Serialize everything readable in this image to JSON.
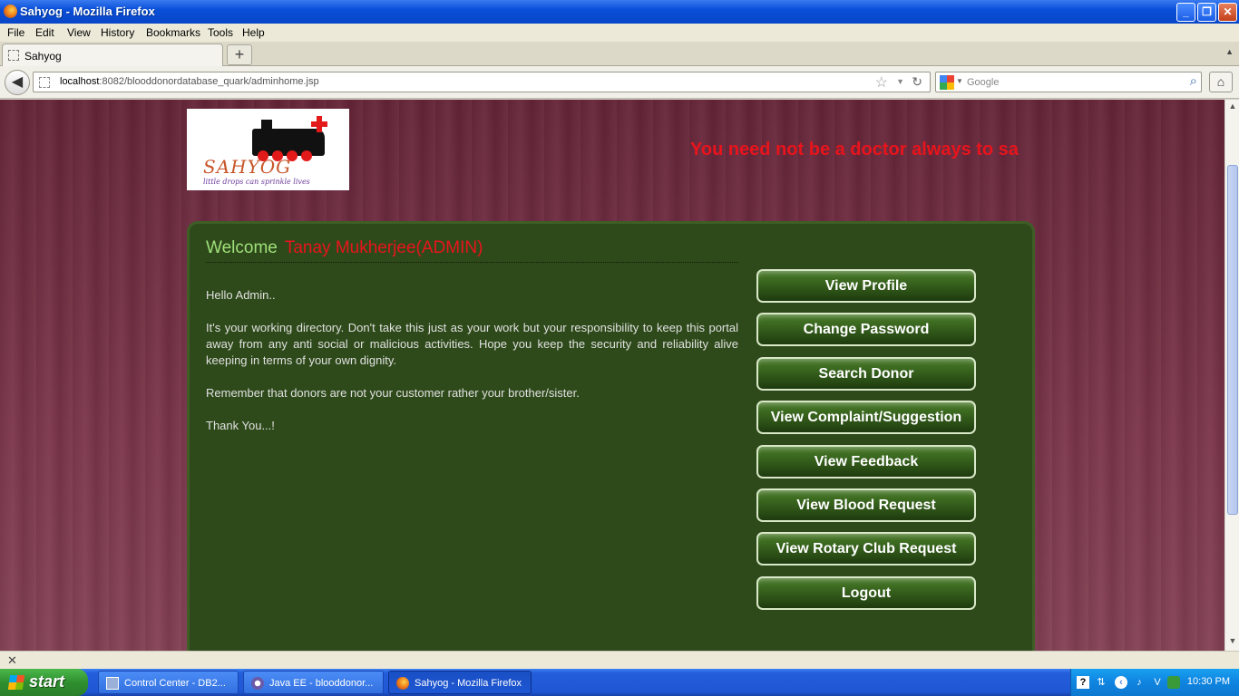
{
  "window": {
    "title": "Sahyog - Mozilla Firefox",
    "buttons": {
      "minimize": "_",
      "maximize": "❐",
      "close": "✕"
    }
  },
  "menubar": [
    "File",
    "Edit",
    "View",
    "History",
    "Bookmarks",
    "Tools",
    "Help"
  ],
  "tab": {
    "label": "Sahyog",
    "new_tab": "+"
  },
  "navbar": {
    "url_host": "localhost",
    "url_path": ":8082/blooddonordatabase_quark/adminhome.jsp",
    "search_placeholder": "Google"
  },
  "page": {
    "logo": {
      "name": "SAHYOG",
      "tagline": "little drops can sprinkle lives"
    },
    "marquee": "You need not be a doctor always to sa",
    "welcome_label": "Welcome",
    "user_name": "Tanay Mukherjee(ADMIN)",
    "paragraphs": [
      "Hello Admin..",
      "It's your working directory. Don't take this just as your work but your responsibility to keep this portal away from any anti social or malicious activities. Hope you keep the security and reliability alive keeping in terms of your own dignity.",
      "Remember that donors are not your customer rather your brother/sister.",
      "Thank You...!"
    ],
    "menu_buttons": [
      "View Profile",
      "Change Password",
      "Search Donor",
      "View Complaint/Suggestion",
      "View Feedback",
      "View Blood Request",
      "View Rotary Club Request",
      "Logout"
    ]
  },
  "taskbar": {
    "start_label": "start",
    "tasks": [
      {
        "label": "Control Center - DB2...",
        "icon": "db2-icon"
      },
      {
        "label": "Java EE - blooddonor...",
        "icon": "eclipse-icon"
      },
      {
        "label": "Sahyog - Mozilla Firefox",
        "icon": "firefox-icon"
      }
    ],
    "clock": "10:30 PM"
  },
  "colors": {
    "accent_red": "#e8141c",
    "welcome_green": "#9fe07a",
    "panel_bg": "#2e4a1a",
    "page_bg": "#6e2e42"
  }
}
